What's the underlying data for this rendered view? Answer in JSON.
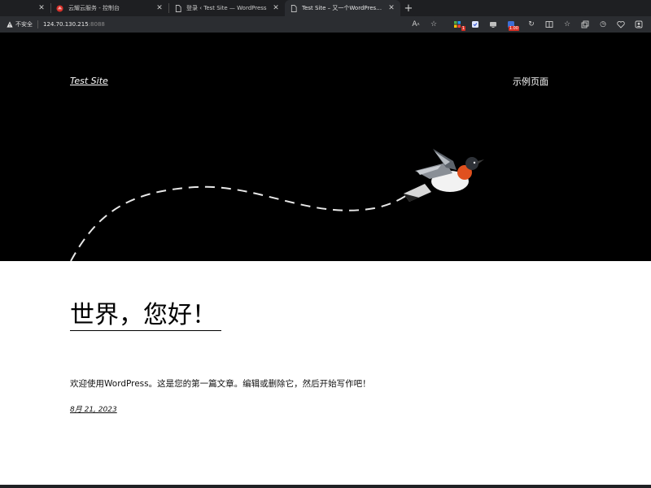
{
  "browser": {
    "tabs": [
      {
        "title": "",
        "active": false,
        "icon": "blank-icon"
      },
      {
        "title": "云耀云服务 - 控制台",
        "active": false,
        "icon": "huawei-cloud-icon"
      },
      {
        "title": "登录 ‹ Test Site — WordPress",
        "active": false,
        "icon": "page-icon"
      },
      {
        "title": "Test Site – 又一个WordPress站点",
        "active": true,
        "icon": "page-icon"
      }
    ],
    "new_tab_label": "+",
    "security_label": "不安全",
    "url_host": "124.70.130.215",
    "url_port": ":8088",
    "badges": {
      "ext1": "1",
      "ext2": "1.00"
    }
  },
  "site": {
    "title": "Test Site",
    "nav_link": "示例页面"
  },
  "post": {
    "title": "世界，您好！",
    "excerpt": "欢迎使用WordPress。这是您的第一篇文章。编辑或删除它，然后开始写作吧！",
    "date": "8月 21, 2023"
  },
  "colors": {
    "hero_bg": "#000000",
    "page_bg": "#ffffff",
    "chrome_bg": "#2b2d31",
    "bird_breast": "#e0501e"
  }
}
